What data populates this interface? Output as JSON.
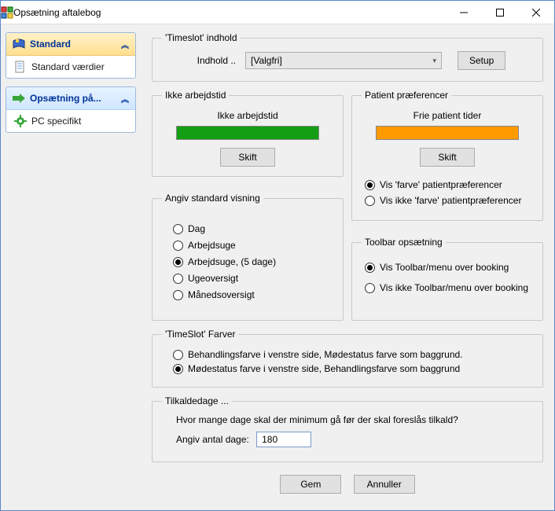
{
  "window": {
    "title": "Opsætning aftalebog"
  },
  "sidebar": {
    "group1": {
      "title": "Standard",
      "items": [
        "Standard værdier"
      ]
    },
    "group2": {
      "title": "Opsætning på...",
      "items": [
        "PC specifikt"
      ]
    }
  },
  "timeslot": {
    "legend": "'Timeslot' indhold",
    "label": "Indhold ..",
    "selected": "[Valgfri]",
    "setup_btn": "Setup"
  },
  "nonwork": {
    "legend": "Ikke arbejdstid",
    "label": "Ikke arbejdstid",
    "change_btn": "Skift",
    "color": "#139e13"
  },
  "patientpref": {
    "legend": "Patient præferencer",
    "label": "Frie patient tider",
    "change_btn": "Skift",
    "color": "#ff9a00",
    "opt1": "Vis 'farve' patientpræferencer",
    "opt2": "Vis ikke 'farve' patientpræferencer",
    "selected_index": 0
  },
  "defaultview": {
    "legend": "Angiv standard visning",
    "options": [
      "Dag",
      "Arbejdsuge",
      "Arbejdsuge, (5 dage)",
      "Ugeoversigt",
      "Månedsoversigt"
    ],
    "selected_index": 2
  },
  "toolbar": {
    "legend": "Toolbar opsætning",
    "opt1": "Vis Toolbar/menu over booking",
    "opt2": "Vis ikke Toolbar/menu over booking",
    "selected_index": 0
  },
  "colors": {
    "legend": "'TimeSlot' Farver",
    "opt1": "Behandlingsfarve i venstre side, Mødestatus farve som baggrund.",
    "opt2": "Mødestatus farve i venstre side, Behandlingsfarve som baggrund",
    "selected_index": 1
  },
  "recall": {
    "legend": "Tilkaldedage ...",
    "question": "Hvor mange dage skal der minimum gå før der skal foreslås tilkald?",
    "input_label": "Angiv antal dage:",
    "value": "180"
  },
  "buttons": {
    "save": "Gem",
    "cancel": "Annuller"
  }
}
